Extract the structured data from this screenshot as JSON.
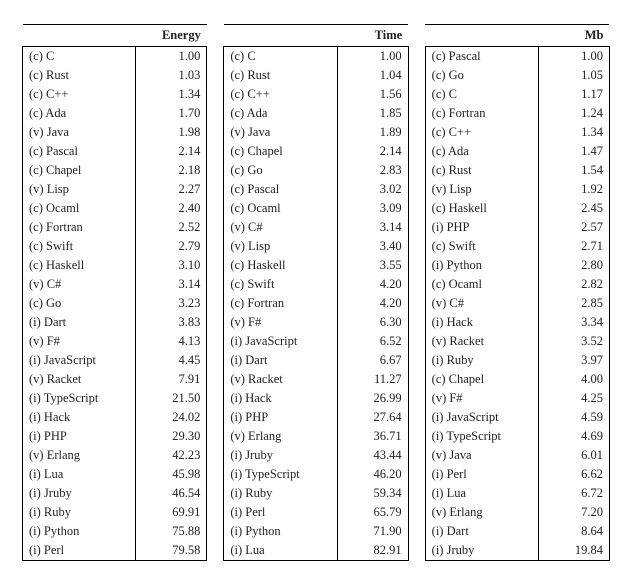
{
  "tables": [
    {
      "header": "Energy",
      "rows": [
        {
          "label": "(c) C",
          "value": "1.00"
        },
        {
          "label": "(c) Rust",
          "value": "1.03"
        },
        {
          "label": "(c) C++",
          "value": "1.34"
        },
        {
          "label": "(c) Ada",
          "value": "1.70"
        },
        {
          "label": "(v) Java",
          "value": "1.98"
        },
        {
          "label": "(c) Pascal",
          "value": "2.14"
        },
        {
          "label": "(c) Chapel",
          "value": "2.18"
        },
        {
          "label": "(v) Lisp",
          "value": "2.27"
        },
        {
          "label": "(c) Ocaml",
          "value": "2.40"
        },
        {
          "label": "(c) Fortran",
          "value": "2.52"
        },
        {
          "label": "(c) Swift",
          "value": "2.79"
        },
        {
          "label": "(c) Haskell",
          "value": "3.10"
        },
        {
          "label": "(v) C#",
          "value": "3.14"
        },
        {
          "label": "(c) Go",
          "value": "3.23"
        },
        {
          "label": "(i) Dart",
          "value": "3.83"
        },
        {
          "label": "(v) F#",
          "value": "4.13"
        },
        {
          "label": "(i) JavaScript",
          "value": "4.45"
        },
        {
          "label": "(v) Racket",
          "value": "7.91"
        },
        {
          "label": "(i) TypeScript",
          "value": "21.50"
        },
        {
          "label": "(i) Hack",
          "value": "24.02"
        },
        {
          "label": "(i) PHP",
          "value": "29.30"
        },
        {
          "label": "(v) Erlang",
          "value": "42.23"
        },
        {
          "label": "(i) Lua",
          "value": "45.98"
        },
        {
          "label": "(i) Jruby",
          "value": "46.54"
        },
        {
          "label": "(i) Ruby",
          "value": "69.91"
        },
        {
          "label": "(i) Python",
          "value": "75.88"
        },
        {
          "label": "(i) Perl",
          "value": "79.58"
        }
      ]
    },
    {
      "header": "Time",
      "rows": [
        {
          "label": "(c) C",
          "value": "1.00"
        },
        {
          "label": "(c) Rust",
          "value": "1.04"
        },
        {
          "label": "(c) C++",
          "value": "1.56"
        },
        {
          "label": "(c) Ada",
          "value": "1.85"
        },
        {
          "label": "(v) Java",
          "value": "1.89"
        },
        {
          "label": "(c) Chapel",
          "value": "2.14"
        },
        {
          "label": "(c) Go",
          "value": "2.83"
        },
        {
          "label": "(c) Pascal",
          "value": "3.02"
        },
        {
          "label": "(c) Ocaml",
          "value": "3.09"
        },
        {
          "label": "(v) C#",
          "value": "3.14"
        },
        {
          "label": "(v) Lisp",
          "value": "3.40"
        },
        {
          "label": "(c) Haskell",
          "value": "3.55"
        },
        {
          "label": "(c) Swift",
          "value": "4.20"
        },
        {
          "label": "(c) Fortran",
          "value": "4.20"
        },
        {
          "label": "(v) F#",
          "value": "6.30"
        },
        {
          "label": "(i) JavaScript",
          "value": "6.52"
        },
        {
          "label": "(i) Dart",
          "value": "6.67"
        },
        {
          "label": "(v) Racket",
          "value": "11.27"
        },
        {
          "label": "(i) Hack",
          "value": "26.99"
        },
        {
          "label": "(i) PHP",
          "value": "27.64"
        },
        {
          "label": "(v) Erlang",
          "value": "36.71"
        },
        {
          "label": "(i) Jruby",
          "value": "43.44"
        },
        {
          "label": "(i) TypeScript",
          "value": "46.20"
        },
        {
          "label": "(i) Ruby",
          "value": "59.34"
        },
        {
          "label": "(i) Perl",
          "value": "65.79"
        },
        {
          "label": "(i) Python",
          "value": "71.90"
        },
        {
          "label": "(i) Lua",
          "value": "82.91"
        }
      ]
    },
    {
      "header": "Mb",
      "rows": [
        {
          "label": "(c) Pascal",
          "value": "1.00"
        },
        {
          "label": "(c) Go",
          "value": "1.05"
        },
        {
          "label": "(c) C",
          "value": "1.17"
        },
        {
          "label": "(c) Fortran",
          "value": "1.24"
        },
        {
          "label": "(c) C++",
          "value": "1.34"
        },
        {
          "label": "(c) Ada",
          "value": "1.47"
        },
        {
          "label": "(c) Rust",
          "value": "1.54"
        },
        {
          "label": "(v) Lisp",
          "value": "1.92"
        },
        {
          "label": "(c) Haskell",
          "value": "2.45"
        },
        {
          "label": "(i) PHP",
          "value": "2.57"
        },
        {
          "label": "(c) Swift",
          "value": "2.71"
        },
        {
          "label": "(i) Python",
          "value": "2.80"
        },
        {
          "label": "(c) Ocaml",
          "value": "2.82"
        },
        {
          "label": "(v) C#",
          "value": "2.85"
        },
        {
          "label": "(i) Hack",
          "value": "3.34"
        },
        {
          "label": "(v) Racket",
          "value": "3.52"
        },
        {
          "label": "(i) Ruby",
          "value": "3.97"
        },
        {
          "label": "(c) Chapel",
          "value": "4.00"
        },
        {
          "label": "(v) F#",
          "value": "4.25"
        },
        {
          "label": "(i) JavaScript",
          "value": "4.59"
        },
        {
          "label": "(i) TypeScript",
          "value": "4.69"
        },
        {
          "label": "(v) Java",
          "value": "6.01"
        },
        {
          "label": "(i) Perl",
          "value": "6.62"
        },
        {
          "label": "(i) Lua",
          "value": "6.72"
        },
        {
          "label": "(v) Erlang",
          "value": "7.20"
        },
        {
          "label": "(i) Dart",
          "value": "8.64"
        },
        {
          "label": "(i) Jruby",
          "value": "19.84"
        }
      ]
    }
  ],
  "chart_data": [
    {
      "type": "table",
      "title": "Energy",
      "categories": [
        "(c) C",
        "(c) Rust",
        "(c) C++",
        "(c) Ada",
        "(v) Java",
        "(c) Pascal",
        "(c) Chapel",
        "(v) Lisp",
        "(c) Ocaml",
        "(c) Fortran",
        "(c) Swift",
        "(c) Haskell",
        "(v) C#",
        "(c) Go",
        "(i) Dart",
        "(v) F#",
        "(i) JavaScript",
        "(v) Racket",
        "(i) TypeScript",
        "(i) Hack",
        "(i) PHP",
        "(v) Erlang",
        "(i) Lua",
        "(i) Jruby",
        "(i) Ruby",
        "(i) Python",
        "(i) Perl"
      ],
      "values": [
        1.0,
        1.03,
        1.34,
        1.7,
        1.98,
        2.14,
        2.18,
        2.27,
        2.4,
        2.52,
        2.79,
        3.1,
        3.14,
        3.23,
        3.83,
        4.13,
        4.45,
        7.91,
        21.5,
        24.02,
        29.3,
        42.23,
        45.98,
        46.54,
        69.91,
        75.88,
        79.58
      ]
    },
    {
      "type": "table",
      "title": "Time",
      "categories": [
        "(c) C",
        "(c) Rust",
        "(c) C++",
        "(c) Ada",
        "(v) Java",
        "(c) Chapel",
        "(c) Go",
        "(c) Pascal",
        "(c) Ocaml",
        "(v) C#",
        "(v) Lisp",
        "(c) Haskell",
        "(c) Swift",
        "(c) Fortran",
        "(v) F#",
        "(i) JavaScript",
        "(i) Dart",
        "(v) Racket",
        "(i) Hack",
        "(i) PHP",
        "(v) Erlang",
        "(i) Jruby",
        "(i) TypeScript",
        "(i) Ruby",
        "(i) Perl",
        "(i) Python",
        "(i) Lua"
      ],
      "values": [
        1.0,
        1.04,
        1.56,
        1.85,
        1.89,
        2.14,
        2.83,
        3.02,
        3.09,
        3.14,
        3.4,
        3.55,
        4.2,
        4.2,
        6.3,
        6.52,
        6.67,
        11.27,
        26.99,
        27.64,
        36.71,
        43.44,
        46.2,
        59.34,
        65.79,
        71.9,
        82.91
      ]
    },
    {
      "type": "table",
      "title": "Mb",
      "categories": [
        "(c) Pascal",
        "(c) Go",
        "(c) C",
        "(c) Fortran",
        "(c) C++",
        "(c) Ada",
        "(c) Rust",
        "(v) Lisp",
        "(c) Haskell",
        "(i) PHP",
        "(c) Swift",
        "(i) Python",
        "(c) Ocaml",
        "(v) C#",
        "(i) Hack",
        "(v) Racket",
        "(i) Ruby",
        "(c) Chapel",
        "(v) F#",
        "(i) JavaScript",
        "(i) TypeScript",
        "(v) Java",
        "(i) Perl",
        "(i) Lua",
        "(v) Erlang",
        "(i) Dart",
        "(i) Jruby"
      ],
      "values": [
        1.0,
        1.05,
        1.17,
        1.24,
        1.34,
        1.47,
        1.54,
        1.92,
        2.45,
        2.57,
        2.71,
        2.8,
        2.82,
        2.85,
        3.34,
        3.52,
        3.97,
        4.0,
        4.25,
        4.59,
        4.69,
        6.01,
        6.62,
        6.72,
        7.2,
        8.64,
        19.84
      ]
    }
  ]
}
